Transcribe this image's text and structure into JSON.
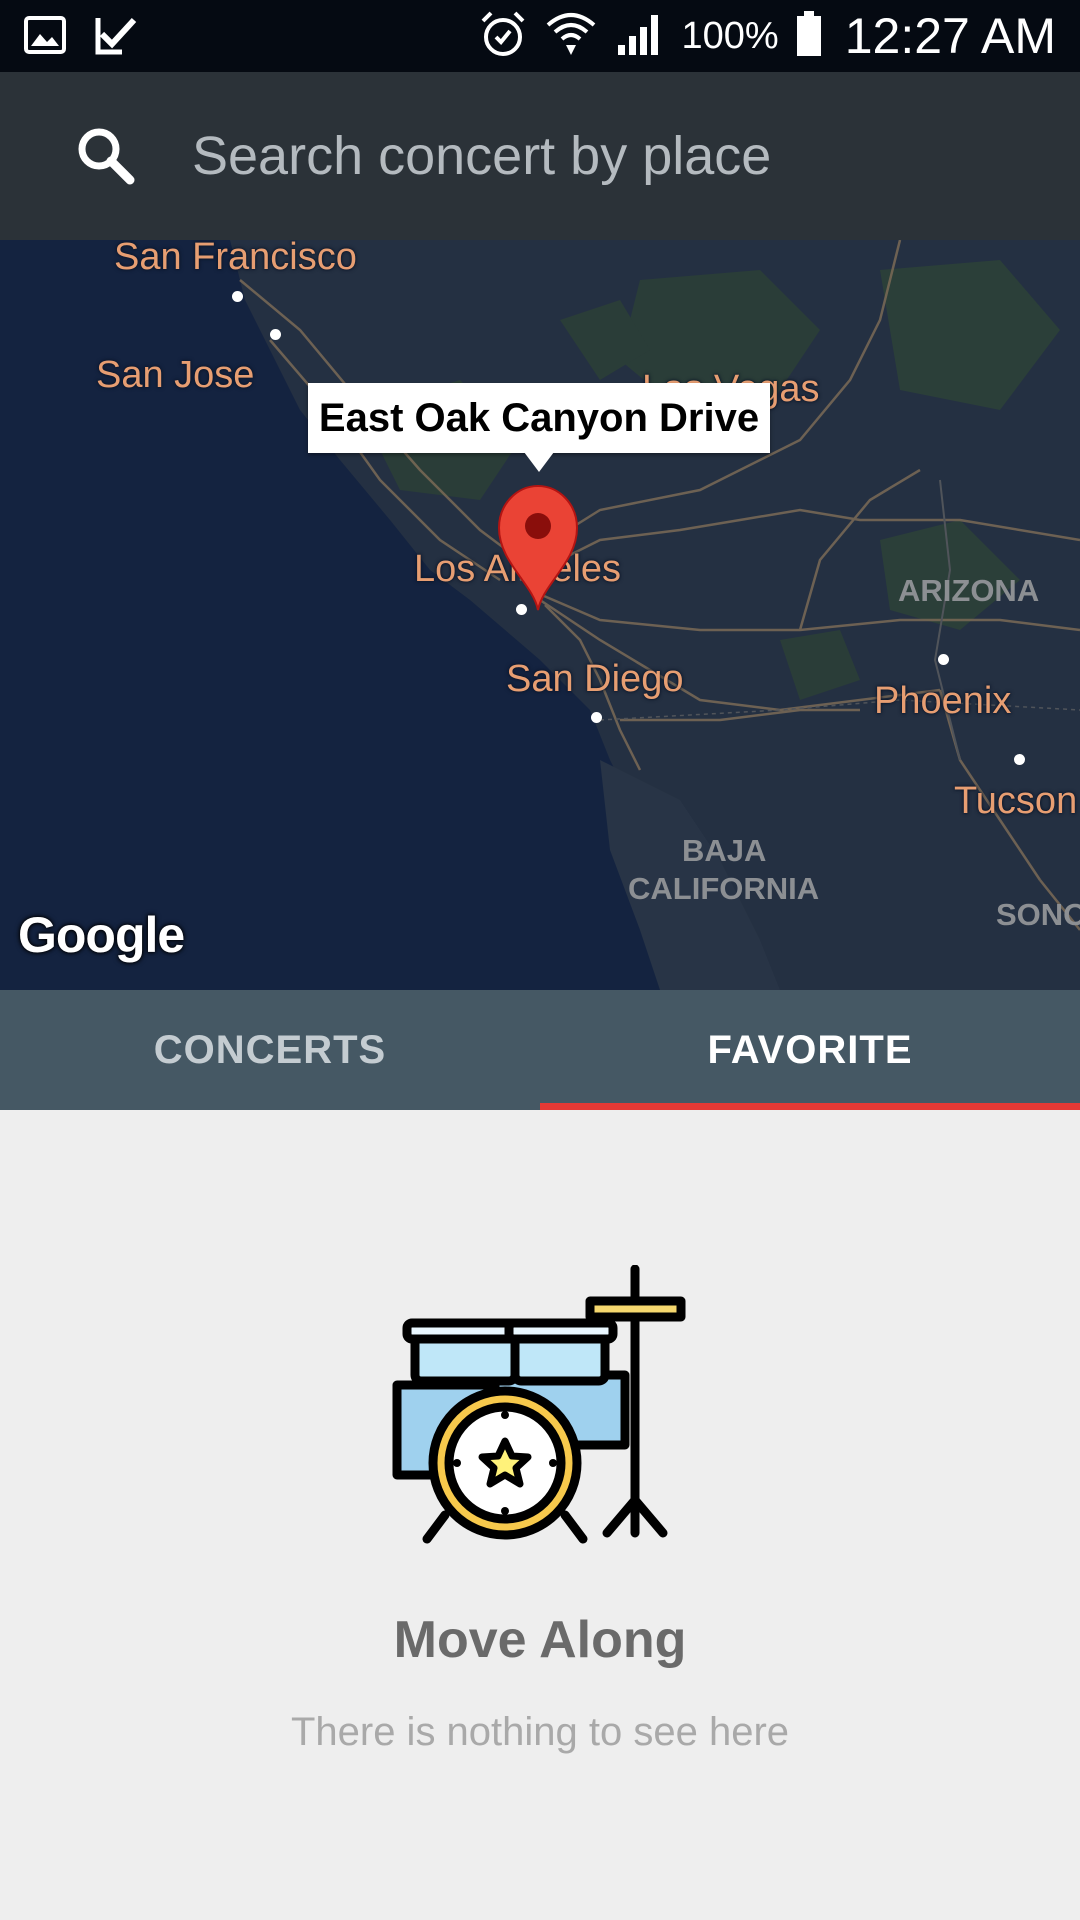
{
  "status_bar": {
    "left_icons": [
      "gallery-icon",
      "task-check-icon"
    ],
    "right_icons": [
      "alarm-icon",
      "wifi-icon",
      "signal-icon",
      "battery-icon"
    ],
    "battery": "100%",
    "time": "12:27 AM"
  },
  "search": {
    "placeholder": "Search concert by place",
    "value": ""
  },
  "map": {
    "cities": {
      "san_francisco": "San Francisco",
      "san_jose": "San Jose",
      "las_vegas": "Las Vegas",
      "los_angeles": "Los Angeles",
      "san_diego": "San Diego",
      "phoenix": "Phoenix",
      "tucson": "Tucson"
    },
    "regions": {
      "arizona": "ARIZONA",
      "baja_line1": "BAJA",
      "baja_line2": "CALIFORNIA",
      "sonora": "SONO"
    },
    "info_window": "East Oak Canyon Drive",
    "attribution": "Google",
    "marker_color": "#ea4335"
  },
  "tabs": [
    {
      "label": "CONCERTS",
      "active": false
    },
    {
      "label": "FAVORITE",
      "active": true
    }
  ],
  "tab_indicator_color": "#e53935",
  "empty_state": {
    "icon": "drum-kit-icon",
    "title": "Move Along",
    "subtitle": "There is nothing to see here"
  }
}
